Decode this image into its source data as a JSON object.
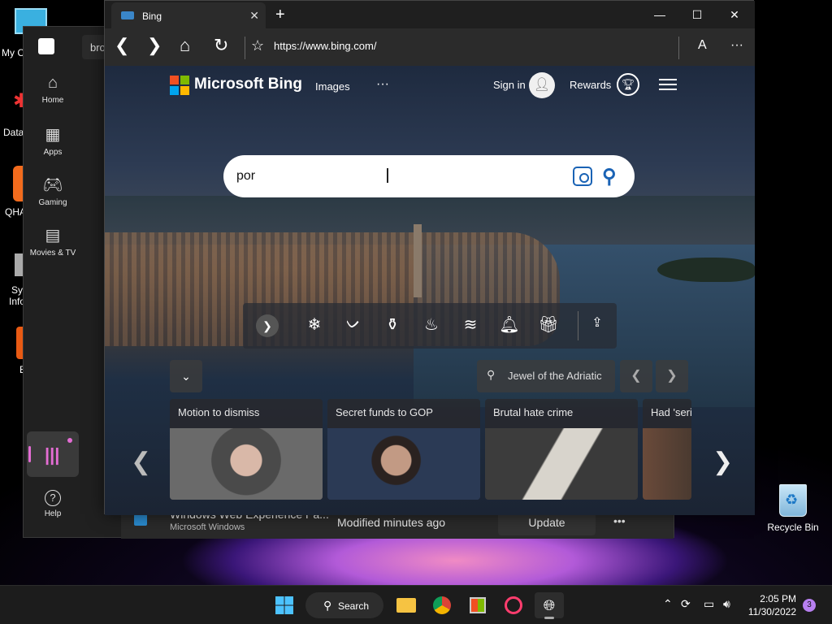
{
  "desktop": {
    "icons": [
      {
        "label": "Recycle Bin"
      },
      {
        "label": "My C"
      },
      {
        "label": "Data"
      },
      {
        "label": "QHA"
      },
      {
        "label": "Sy Info"
      },
      {
        "label": "E"
      }
    ]
  },
  "store": {
    "tab_fragment": "bro",
    "nav": [
      {
        "label": "Home",
        "icon": "home-icon"
      },
      {
        "label": "Apps",
        "icon": "apps-icon"
      },
      {
        "label": "Gaming",
        "icon": "gamepad-icon"
      },
      {
        "label": "Movies & TV",
        "icon": "clapperboard-icon"
      }
    ],
    "help_label": "Help",
    "update_row": {
      "title": "Windows Web Experience Pa...",
      "publisher": "Microsoft Windows",
      "status": "Modified minutes ago",
      "action": "Update",
      "more": "•••"
    }
  },
  "browser": {
    "tab_title": "Bing",
    "url": "https://www.bing.com/",
    "new_tab": "+",
    "close_tab": "✕"
  },
  "bing": {
    "brand": "Microsoft Bing",
    "nav_images": "Images",
    "nav_more": "···",
    "sign_in": "Sign in",
    "rewards": "Rewards",
    "search_value": "por",
    "location": "Jewel of the Adriatic",
    "news": [
      {
        "title": "Motion to dismiss"
      },
      {
        "title": "Secret funds to GOP"
      },
      {
        "title": "Brutal hate crime"
      },
      {
        "title": "Had 'seri"
      }
    ]
  },
  "taskbar": {
    "search_label": "Search",
    "time": "2:05 PM",
    "date": "11/30/2022",
    "notifications": "3"
  },
  "colors": {
    "bing_blue": "#1a63b5",
    "library_pink": "#e46dd4",
    "taskbar": "#1c1c1c"
  }
}
